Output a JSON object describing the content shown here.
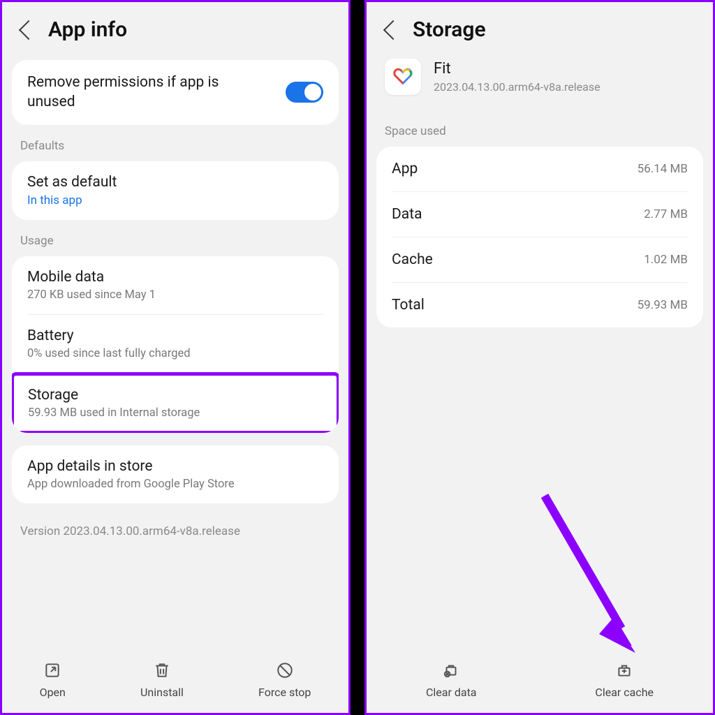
{
  "left": {
    "title": "App info",
    "remove_perms": {
      "label": "Remove permissions if app is unused",
      "toggle_on": true
    },
    "defaults_label": "Defaults",
    "set_default": {
      "title": "Set as default",
      "sub": "In this app"
    },
    "usage_label": "Usage",
    "mobile_data": {
      "title": "Mobile data",
      "sub": "270 KB used since May 1"
    },
    "battery": {
      "title": "Battery",
      "sub": "0% used since last fully charged"
    },
    "storage": {
      "title": "Storage",
      "sub": "59.93 MB used in Internal storage"
    },
    "app_details": {
      "title": "App details in store",
      "sub": "App downloaded from Google Play Store"
    },
    "version": "Version 2023.04.13.00.arm64-v8a.release",
    "buttons": {
      "open": "Open",
      "uninstall": "Uninstall",
      "force_stop": "Force stop"
    }
  },
  "right": {
    "title": "Storage",
    "app_name": "Fit",
    "app_version": "2023.04.13.00.arm64-v8a.release",
    "space_used_label": "Space used",
    "rows": {
      "app": {
        "label": "App",
        "value": "56.14 MB"
      },
      "data": {
        "label": "Data",
        "value": "2.77 MB"
      },
      "cache": {
        "label": "Cache",
        "value": "1.02 MB"
      },
      "total": {
        "label": "Total",
        "value": "59.93 MB"
      }
    },
    "buttons": {
      "clear_data": "Clear data",
      "clear_cache": "Clear cache"
    }
  }
}
